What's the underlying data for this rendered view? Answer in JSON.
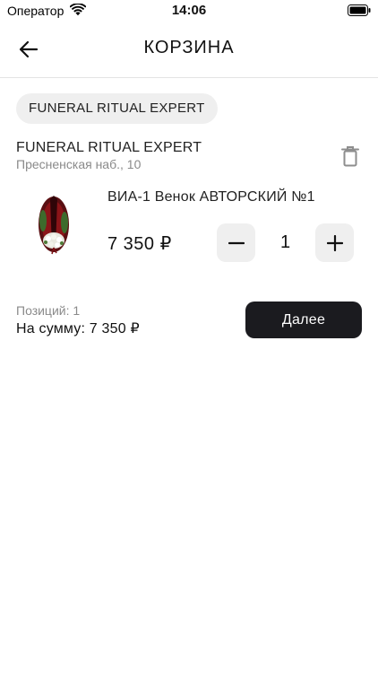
{
  "status_bar": {
    "carrier": "Оператор",
    "time": "14:06"
  },
  "header": {
    "title": "КОРЗИНА",
    "back_icon": "arrow-left-icon"
  },
  "shop_filter": {
    "label": "FUNERAL RITUAL EXPERT"
  },
  "shop": {
    "name": "FUNERAL RITUAL EXPERT",
    "address": "Пресненская наб., 10",
    "delete_icon": "trash-icon"
  },
  "cart_item": {
    "name": "ВИА-1 Венок АВТОРСКИЙ №1",
    "price": "7 350 ₽",
    "quantity": "1",
    "decrement_icon": "minus-icon",
    "increment_icon": "plus-icon"
  },
  "summary": {
    "positions": "Позиций: 1",
    "total": "На сумму: 7 350 ₽"
  },
  "actions": {
    "next_label": "Далее"
  },
  "colors": {
    "primary_button": "#1b1b1f",
    "chip_bg": "#efefef",
    "secondary_text": "#8a8a8a"
  }
}
